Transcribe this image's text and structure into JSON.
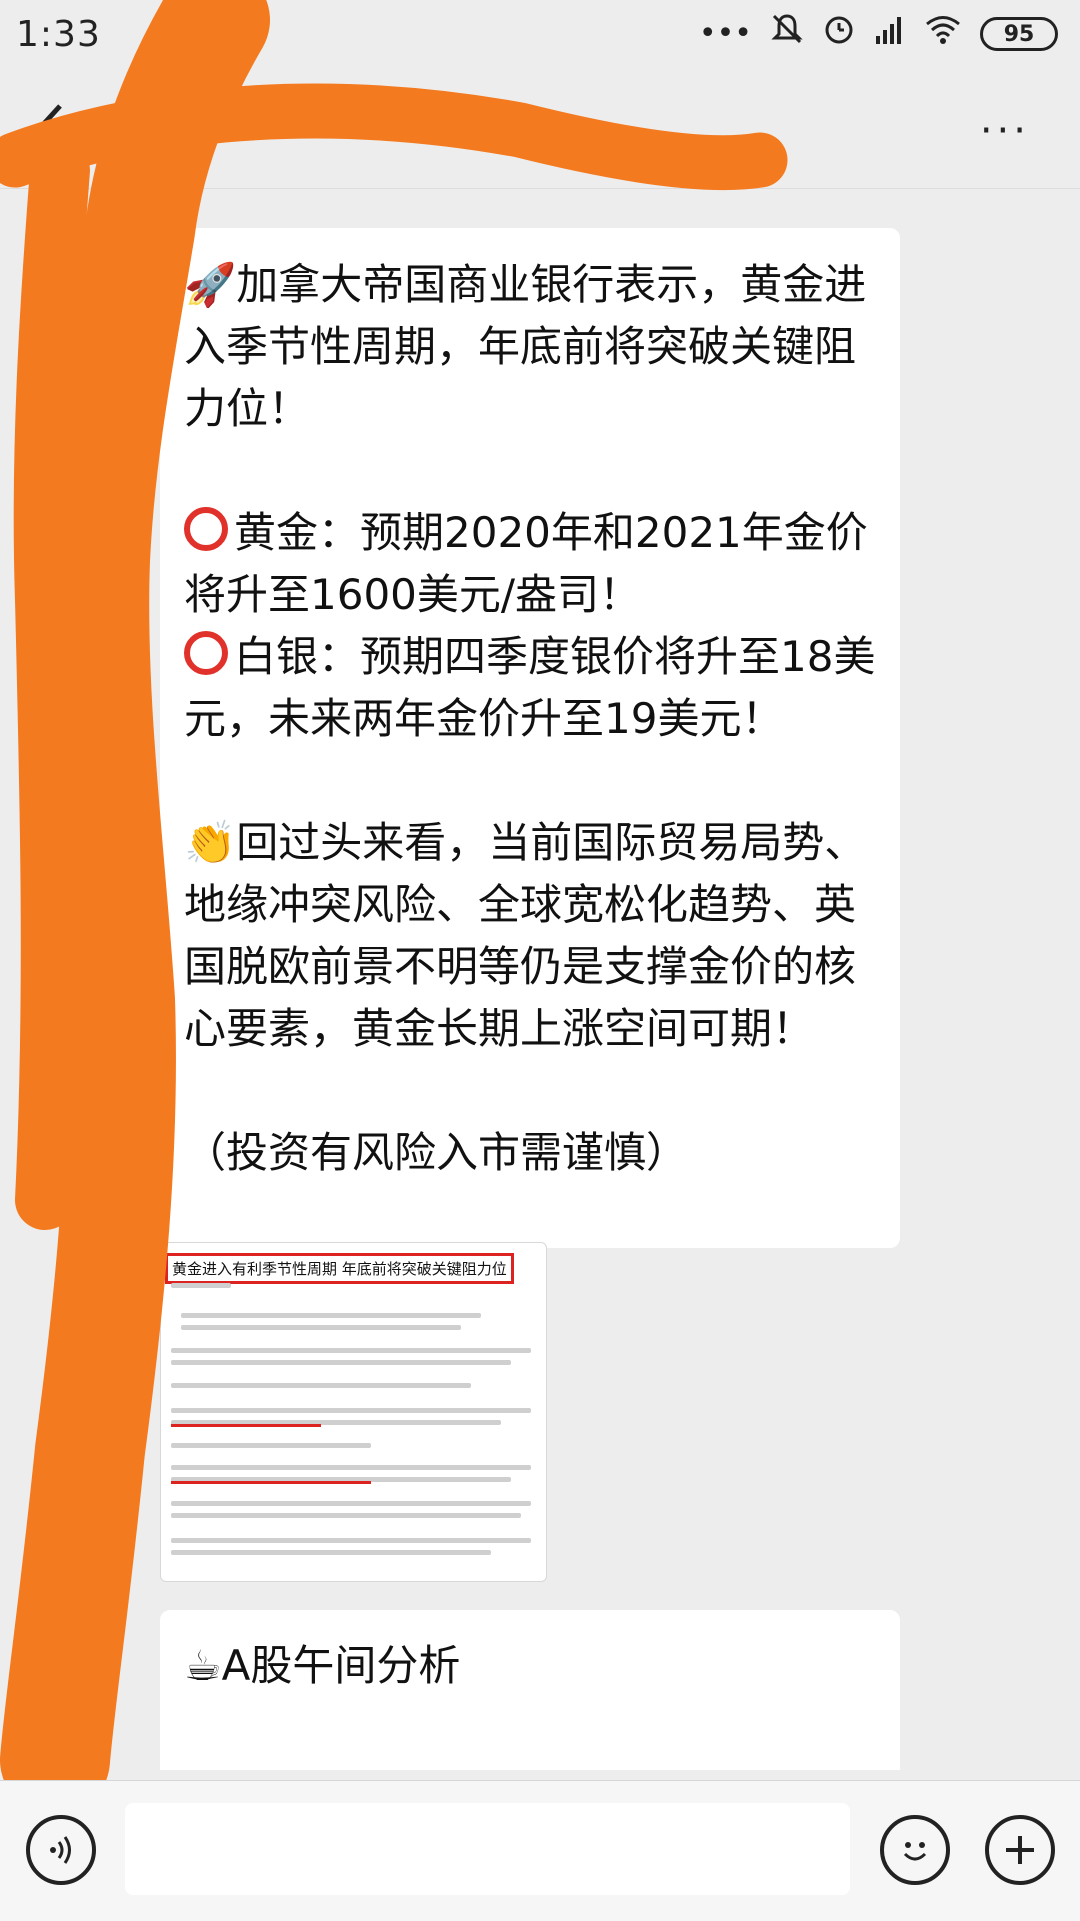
{
  "status_bar": {
    "time": "1:33",
    "battery": "95",
    "icons": [
      "more-dots-icon",
      "mute-icon",
      "alarm-icon",
      "signal-icon",
      "wifi-icon",
      "battery-icon"
    ]
  },
  "nav": {
    "back_icon": "chevron-left-icon",
    "more_label": "···"
  },
  "messages": {
    "message1": {
      "para1": "加拿大帝国商业银行表示，黄金进入季节性周期，年底前将突破关键阻力位！",
      "para2_a": "黄金：预期2020年和2021年金价将升至1600美元/盎司！",
      "para2_b": "白银：预期四季度银价将升至18美元，未来两年金价升至19美元！",
      "para3": "回过头来看，当前国际贸易局势、地缘冲突风险、全球宽松化趋势、英国脱欧前景不明等仍是支撑金价的核心要素，黄金长期上涨空间可期！",
      "para4": "（投资有风险入市需谨慎）"
    },
    "image_message": {
      "headline": "黄金进入有利季节性周期 年底前将突破关键阻力位"
    },
    "message2": {
      "text": "A股午间分析"
    }
  },
  "colors": {
    "background": "#ededed",
    "bubble": "#ffffff",
    "scribble": "#f47a20",
    "red_emoji": "#e0322a"
  }
}
